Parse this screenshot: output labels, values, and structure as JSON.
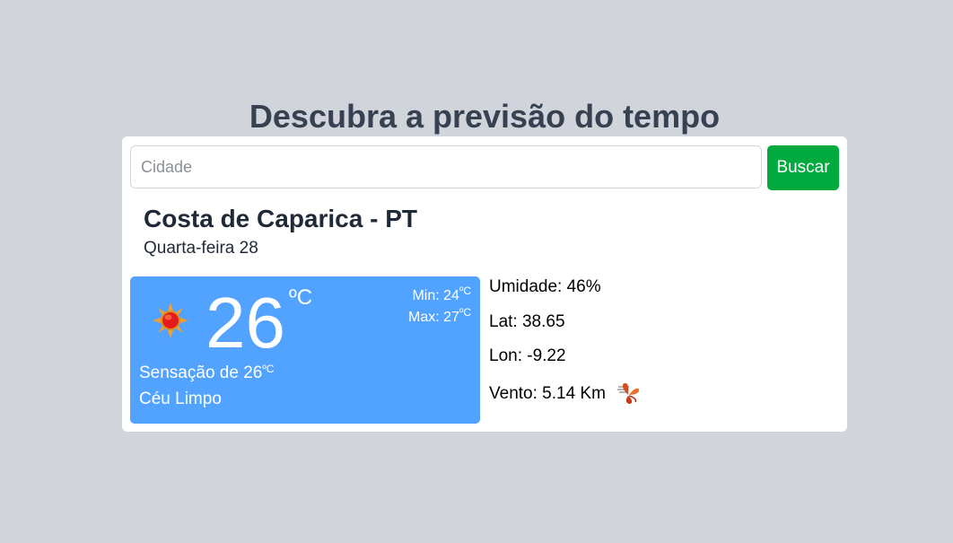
{
  "page": {
    "title": "Descubra a previsão do tempo"
  },
  "search": {
    "placeholder": "Cidade",
    "value": "",
    "button_label": "Buscar"
  },
  "location": {
    "city": "Costa de Caparica - PT",
    "date": "Quarta-feira 28"
  },
  "current": {
    "icon": "sun-icon",
    "temperature": "26",
    "unit": "ºC",
    "min_label": "Min: 24",
    "max_label": "Max: 27",
    "feels_like_label": "Sensação de 26",
    "condition": "Céu Limpo"
  },
  "details": {
    "humidity": "Umidade: 46%",
    "lat": "Lat: 38.65",
    "lon": "Lon: -9.22",
    "wind": "Vento: 5.14 Km",
    "wind_icon": "wind-icon"
  },
  "colors": {
    "background": "#d1d5db",
    "card": "#ffffff",
    "accent_button": "#00aa3f",
    "weather_box": "#52a3ff",
    "title_text": "#374151"
  }
}
